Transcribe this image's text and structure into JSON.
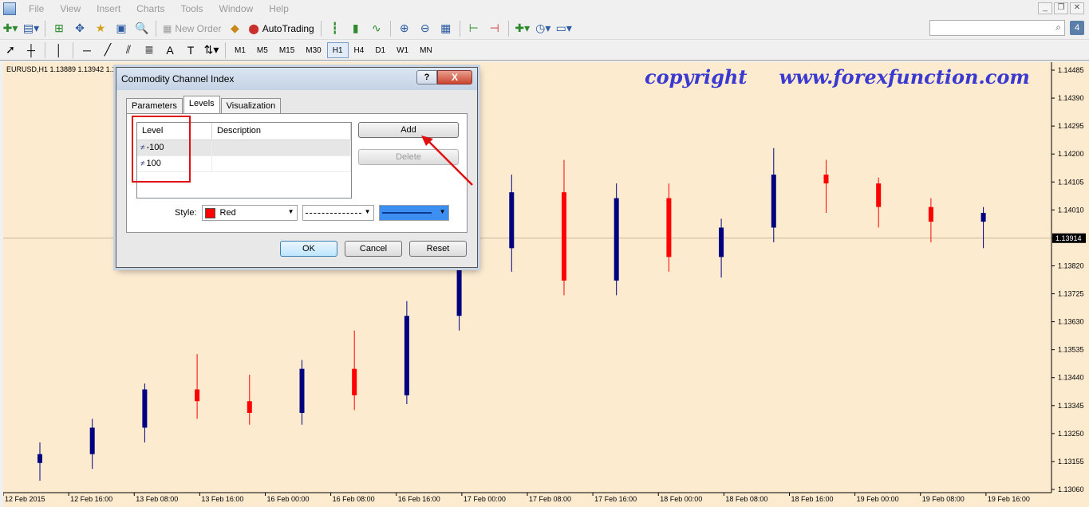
{
  "menu": {
    "items": [
      "File",
      "View",
      "Insert",
      "Charts",
      "Tools",
      "Window",
      "Help"
    ]
  },
  "toolbar": {
    "new_order_label": "New Order",
    "autotrading_label": "AutoTrading",
    "timeframes": [
      "M1",
      "M5",
      "M15",
      "M30",
      "H1",
      "H4",
      "D1",
      "W1",
      "MN"
    ],
    "active_timeframe": "H1"
  },
  "search": {
    "placeholder": "",
    "badge": "4"
  },
  "chart": {
    "symbol_label": "EURUSD,H1  1.13889 1.13942 1.13...",
    "watermark_left": "copyright",
    "watermark_right": "www.forexfunction.com",
    "current_price": "1.13914",
    "colors": {
      "background": "#fdebd0",
      "bull": "#000080",
      "bear": "#ff0000",
      "price_line": "#c8b8a0"
    }
  },
  "chart_data": {
    "type": "candlestick",
    "x_tick_labels": [
      "12 Feb 2015",
      "12 Feb 16:00",
      "13 Feb 08:00",
      "13 Feb 16:00",
      "16 Feb 00:00",
      "16 Feb 08:00",
      "16 Feb 16:00",
      "17 Feb 00:00",
      "17 Feb 08:00",
      "17 Feb 16:00",
      "18 Feb 00:00",
      "18 Feb 08:00",
      "18 Feb 16:00",
      "19 Feb 00:00",
      "19 Feb 08:00",
      "19 Feb 16:00"
    ],
    "y_tick_labels": [
      "1.14485",
      "1.14390",
      "1.14295",
      "1.14200",
      "1.14105",
      "1.14010",
      "1.13914",
      "1.13820",
      "1.13725",
      "1.13630",
      "1.13535",
      "1.13440",
      "1.13345",
      "1.13250",
      "1.13155",
      "1.13060"
    ],
    "ylim": [
      1.1306,
      1.14485
    ],
    "candles": [
      {
        "o": 1.1315,
        "h": 1.1322,
        "l": 1.1309,
        "c": 1.1318
      },
      {
        "o": 1.1318,
        "h": 1.133,
        "l": 1.1313,
        "c": 1.1327
      },
      {
        "o": 1.1327,
        "h": 1.1342,
        "l": 1.1322,
        "c": 1.134
      },
      {
        "o": 1.134,
        "h": 1.1352,
        "l": 1.133,
        "c": 1.1336
      },
      {
        "o": 1.1336,
        "h": 1.1345,
        "l": 1.1328,
        "c": 1.1332
      },
      {
        "o": 1.1332,
        "h": 1.135,
        "l": 1.1328,
        "c": 1.1347
      },
      {
        "o": 1.1347,
        "h": 1.136,
        "l": 1.1333,
        "c": 1.1338
      },
      {
        "o": 1.1338,
        "h": 1.137,
        "l": 1.1335,
        "c": 1.1365
      },
      {
        "o": 1.1365,
        "h": 1.1392,
        "l": 1.136,
        "c": 1.1388
      },
      {
        "o": 1.1388,
        "h": 1.1413,
        "l": 1.138,
        "c": 1.1407
      },
      {
        "o": 1.1407,
        "h": 1.1418,
        "l": 1.1372,
        "c": 1.1377
      },
      {
        "o": 1.1377,
        "h": 1.141,
        "l": 1.1372,
        "c": 1.1405
      },
      {
        "o": 1.1405,
        "h": 1.141,
        "l": 1.138,
        "c": 1.1385
      },
      {
        "o": 1.1385,
        "h": 1.1398,
        "l": 1.1378,
        "c": 1.1395
      },
      {
        "o": 1.1395,
        "h": 1.1422,
        "l": 1.139,
        "c": 1.1413
      },
      {
        "o": 1.1413,
        "h": 1.1418,
        "l": 1.14,
        "c": 1.141
      },
      {
        "o": 1.141,
        "h": 1.1412,
        "l": 1.1395,
        "c": 1.1402
      },
      {
        "o": 1.1402,
        "h": 1.1405,
        "l": 1.139,
        "c": 1.1397
      },
      {
        "o": 1.1397,
        "h": 1.1402,
        "l": 1.1388,
        "c": 1.14
      }
    ]
  },
  "dialog": {
    "title": "Commodity Channel Index",
    "help_label": "?",
    "close_label": "X",
    "tabs": [
      "Parameters",
      "Levels",
      "Visualization"
    ],
    "active_tab": "Levels",
    "list_headers": {
      "level": "Level",
      "description": "Description"
    },
    "levels": [
      {
        "value": "-100",
        "description": ""
      },
      {
        "value": "100",
        "description": ""
      }
    ],
    "buttons": {
      "add": "Add",
      "delete": "Delete",
      "ok": "OK",
      "cancel": "Cancel",
      "reset": "Reset"
    },
    "style_label": "Style:",
    "style_color_name": "Red",
    "style_color_hex": "#ff0000"
  }
}
